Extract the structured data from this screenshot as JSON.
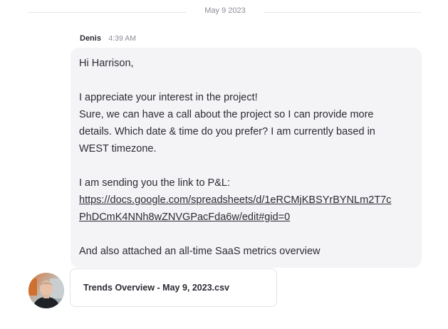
{
  "date_divider": {
    "label": "May 9 2023"
  },
  "message": {
    "sender": "Denis",
    "time": "4:39 AM",
    "lines": {
      "greeting": "Hi Harrison,",
      "p1_l1": "I appreciate your interest in the project!",
      "p1_l2": "Sure, we can have a call about the project so I can provide more",
      "p1_l3": "details. Which date & time do you prefer? I am currently based in",
      "p1_l4": "WEST timezone.",
      "p2_l1": "I am sending you the link to P&L:",
      "link_l1": "https://docs.google.com/spreadsheets/d/1eRCMjKBSYrBYNLm2T7c",
      "link_l2": "PhDCmK4NNh8wZNVGPacFda6w/edit#gid=0",
      "p3_l1": "And also attached an all-time SaaS metrics overview"
    }
  },
  "attachment": {
    "file_name": "Trends Overview - May 9, 2023.csv"
  },
  "colors": {
    "bubble_bg": "#f4f4f7",
    "text": "#2b2b33",
    "muted": "#8a8d96",
    "border": "#e3e3e8"
  }
}
